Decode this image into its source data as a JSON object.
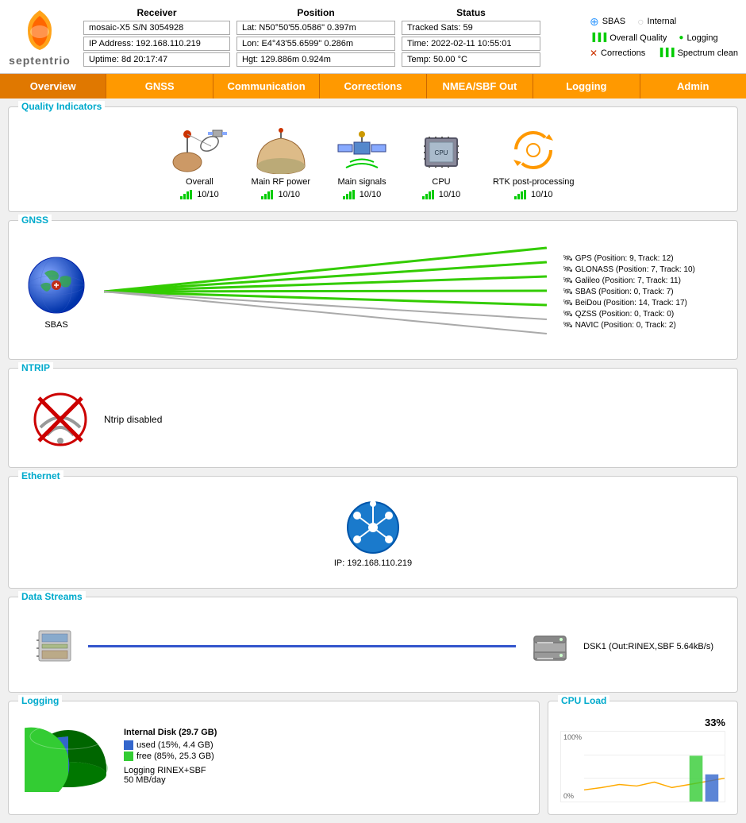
{
  "header": {
    "logo_text": "septentrio",
    "receiver": {
      "title": "Receiver",
      "fields": [
        "mosaic-X5 S/N 3054928",
        "IP Address: 192.168.110.219",
        "Uptime: 8d 20:17:47"
      ]
    },
    "position": {
      "title": "Position",
      "fields": [
        "Lat:  N50°50'55.0586\"   0.397m",
        "Lon: E4°43'55.6599\"    0.286m",
        "Hgt: 129.886m            0.924m"
      ]
    },
    "status": {
      "title": "Status",
      "fields": [
        "Tracked Sats: 59",
        "Time: 2022-02-11  10:55:01",
        "Temp: 50.00 °C"
      ]
    },
    "indicators": {
      "sbas_label": "SBAS",
      "overall_quality_label": "Overall Quality",
      "corrections_label": "Corrections",
      "internal_label": "Internal",
      "logging_label": "Logging",
      "spectrum_clean_label": "Spectrum clean"
    }
  },
  "nav": {
    "items": [
      "Overview",
      "GNSS",
      "Communication",
      "Corrections",
      "NMEA/SBF Out",
      "Logging",
      "Admin"
    ]
  },
  "quality_indicators": {
    "title": "Quality Indicators",
    "items": [
      {
        "label": "Overall",
        "score": "10/10"
      },
      {
        "label": "Main RF power",
        "score": "10/10"
      },
      {
        "label": "Main signals",
        "score": "10/10"
      },
      {
        "label": "CPU",
        "score": "10/10"
      },
      {
        "label": "RTK post-processing",
        "score": "10/10"
      }
    ]
  },
  "gnss": {
    "title": "GNSS",
    "globe_label": "SBAS",
    "legend": [
      "GPS (Position: 9, Track: 12)",
      "GLONASS (Position: 7, Track: 10)",
      "Galileo (Position: 7, Track: 11)",
      "SBAS (Position: 0, Track: 7)",
      "BeiDou (Position: 14, Track: 17)",
      "QZSS (Position: 0, Track: 0)",
      "NAVIC (Position: 0, Track: 2)"
    ],
    "line_colors": [
      "#33cc00",
      "#33cc00",
      "#33cc00",
      "#33cc00",
      "#33cc00",
      "#aaaaaa",
      "#aaaaaa"
    ]
  },
  "ntrip": {
    "title": "NTRIP",
    "status": "Ntrip disabled"
  },
  "ethernet": {
    "title": "Ethernet",
    "ip": "IP: 192.168.110.219"
  },
  "data_streams": {
    "title": "Data Streams",
    "stream_label": "DSK1 (Out:RINEX,SBF 5.64kB/s)"
  },
  "logging": {
    "title": "Logging",
    "disk_label": "Internal Disk (29.7 GB)",
    "used_label": "used (15%, 4.4 GB)",
    "free_label": "free (85%, 25.3 GB)",
    "format_label": "Logging RINEX+SBF",
    "rate_label": "50 MB/day",
    "used_pct": 15,
    "free_pct": 85
  },
  "cpu_load": {
    "title": "CPU Load",
    "percent": "33%",
    "max_label": "100%",
    "min_label": "0%"
  }
}
